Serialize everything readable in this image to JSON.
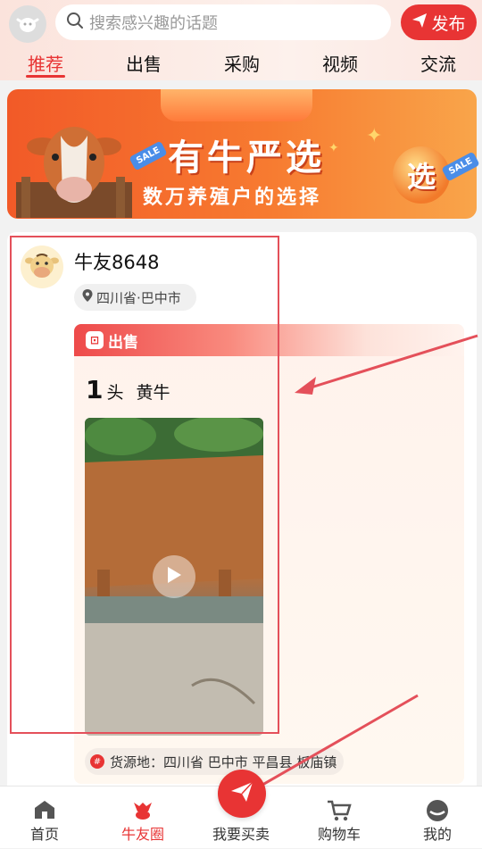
{
  "header": {
    "search_placeholder": "搜索感兴趣的话题",
    "publish_label": "发布",
    "tabs": [
      {
        "label": "推荐",
        "active": true
      },
      {
        "label": "出售",
        "active": false
      },
      {
        "label": "采购",
        "active": false
      },
      {
        "label": "视频",
        "active": false
      },
      {
        "label": "交流",
        "active": false
      }
    ]
  },
  "banner": {
    "title": "有牛严选",
    "subtitle": "数万养殖户的选择",
    "badge_text": "选",
    "sale_tag": "SALE"
  },
  "post": {
    "username": "牛友8648",
    "location": "四川省·巴中市",
    "type_label": "出售",
    "quantity": "1",
    "unit": "头",
    "breed": "黄牛",
    "origin": "货源地：四川省 巴中市 平昌县 板庙镇"
  },
  "bottom_nav": {
    "items": [
      {
        "label": "首页",
        "icon": "home-icon",
        "active": false
      },
      {
        "label": "牛友圈",
        "icon": "community-icon",
        "active": true
      },
      {
        "label": "我要买卖",
        "icon": "paper-plane-icon",
        "active": false
      },
      {
        "label": "购物车",
        "icon": "cart-icon",
        "active": false
      },
      {
        "label": "我的",
        "icon": "profile-icon",
        "active": false
      }
    ]
  },
  "colors": {
    "accent": "#e83434",
    "annotation": "#e4505a"
  }
}
